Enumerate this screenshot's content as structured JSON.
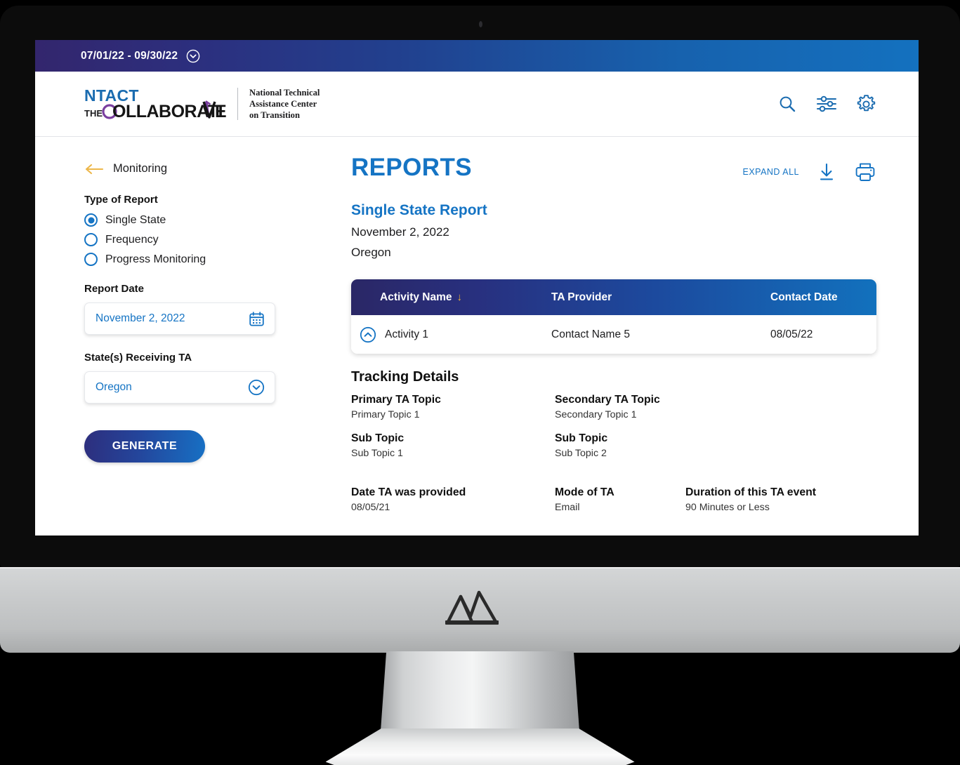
{
  "datebar": {
    "range": "07/01/22 - 09/30/22",
    "chevron_icon": "chevron-down-circle-icon"
  },
  "brand": {
    "logo_top": "NTACT",
    "logo_the": "THE",
    "logo_bottom": "COLLABORATIVE",
    "tagline_line1": "National Technical",
    "tagline_line2": "Assistance Center",
    "tagline_line3": "on Transition",
    "icons": [
      "search-icon",
      "filter-sliders-icon",
      "gear-icon"
    ]
  },
  "sidebar": {
    "back_label": "Monitoring",
    "back_icon": "arrow-left-icon",
    "type_of_report_label": "Type of Report",
    "report_types": [
      {
        "label": "Single State",
        "selected": true
      },
      {
        "label": "Frequency",
        "selected": false
      },
      {
        "label": "Progress Monitoring",
        "selected": false
      }
    ],
    "report_date_label": "Report Date",
    "report_date_value": "November 2, 2022",
    "report_date_icon": "calendar-icon",
    "states_label": "State(s) Receiving TA",
    "states_value": "Oregon",
    "states_icon": "chevron-down-circle-icon",
    "generate_label": "GENERATE"
  },
  "main": {
    "page_title": "REPORTS",
    "expand_all_label": "EXPAND ALL",
    "download_icon": "download-icon",
    "print_icon": "print-icon",
    "report_kicker": "Single State Report",
    "report_date": "November 2, 2022",
    "report_state": "Oregon",
    "table": {
      "columns": [
        "Activity Name",
        "TA Provider",
        "Contact Date"
      ],
      "sort_column": "Activity Name",
      "sort_direction_icon": "arrow-down-icon",
      "rows": [
        {
          "expand_icon": "chevron-up-circle-icon",
          "activity_name": "Activity 1",
          "ta_provider": "Contact Name 5",
          "contact_date": "08/05/22"
        }
      ]
    },
    "tracking": {
      "title": "Tracking Details",
      "fields": [
        {
          "key": "Primary TA Topic",
          "value": "Primary Topic 1"
        },
        {
          "key": "Secondary TA Topic",
          "value": "Secondary Topic 1"
        },
        {
          "key": "Sub Topic",
          "value": "Sub Topic 1"
        },
        {
          "key": "Sub Topic",
          "value": "Sub Topic 2"
        },
        {
          "key": "Date TA was provided",
          "value": "08/05/21"
        },
        {
          "key": "Mode of TA",
          "value": "Email"
        },
        {
          "key": "Duration of this TA event",
          "value": "90 Minutes or Less"
        }
      ]
    }
  },
  "device": {
    "stand_logo": "mountain-m-logo"
  },
  "colors": {
    "accent_blue": "#1574c4",
    "deep_navy": "#2a2766",
    "gold": "#f1b434"
  }
}
